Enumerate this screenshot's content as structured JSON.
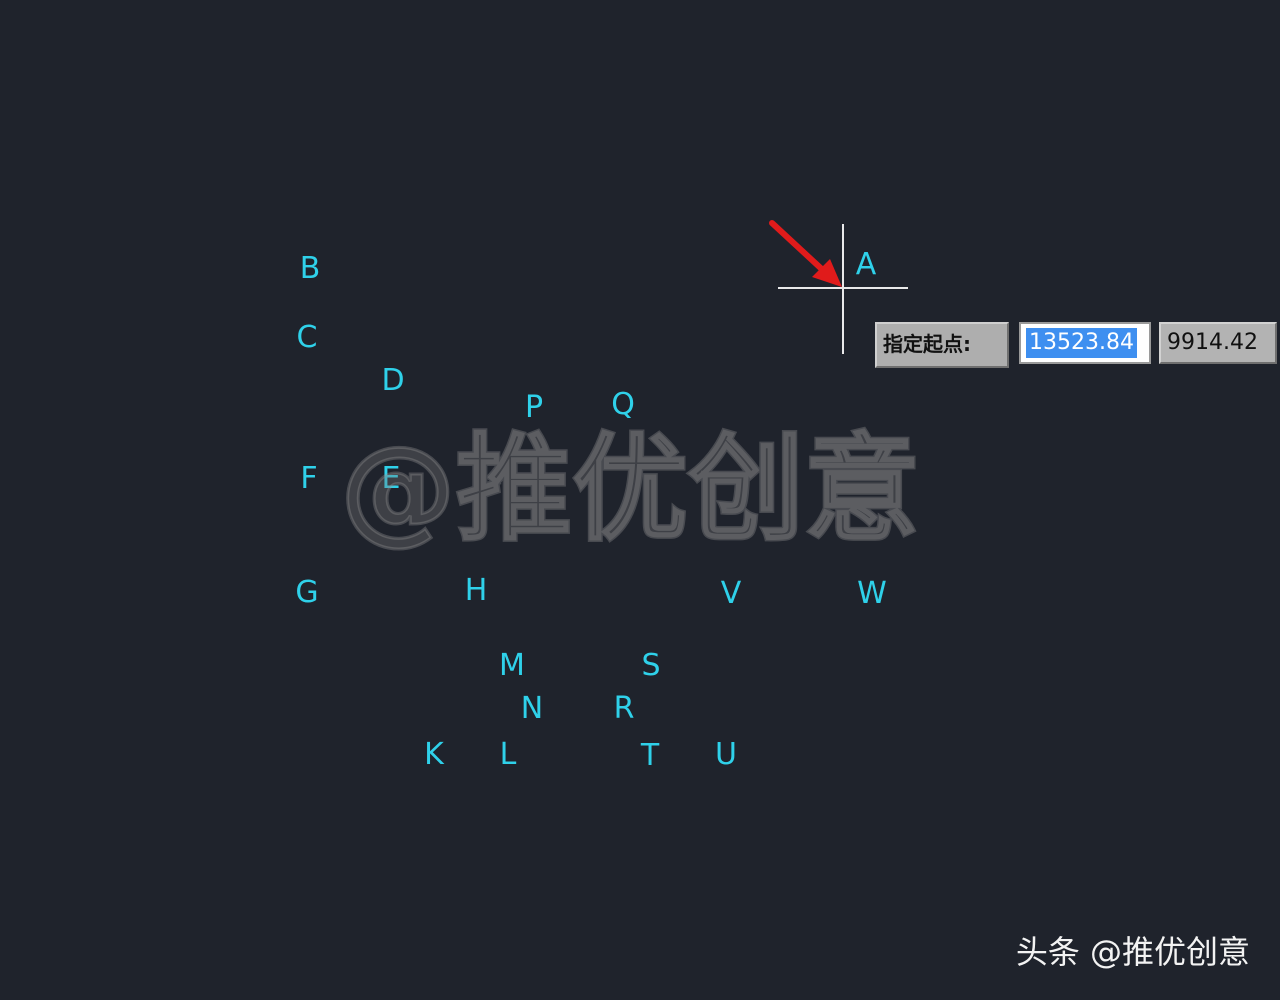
{
  "points": {
    "A": "A",
    "B": "B",
    "C": "C",
    "D": "D",
    "E": "E",
    "F": "F",
    "G": "G",
    "H": "H",
    "K": "K",
    "L": "L",
    "M": "M",
    "N": "N",
    "P": "P",
    "Q": "Q",
    "R": "R",
    "S": "S",
    "T": "T",
    "U": "U",
    "V": "V",
    "W": "W"
  },
  "prompt": {
    "label": "指定起点:",
    "x_value": "13523.84",
    "y_value": "9914.42"
  },
  "watermark": {
    "center_text": "@推优创意",
    "footer_text": "头条 @推优创意"
  },
  "colors": {
    "background": "#1f232c",
    "point_label": "#2fd1ea",
    "arrow": "#e01b1b",
    "crosshair": "#e9e9ea"
  },
  "icons": {
    "cursor": "crosshair-cursor-icon",
    "pointer": "red-arrow-icon"
  }
}
